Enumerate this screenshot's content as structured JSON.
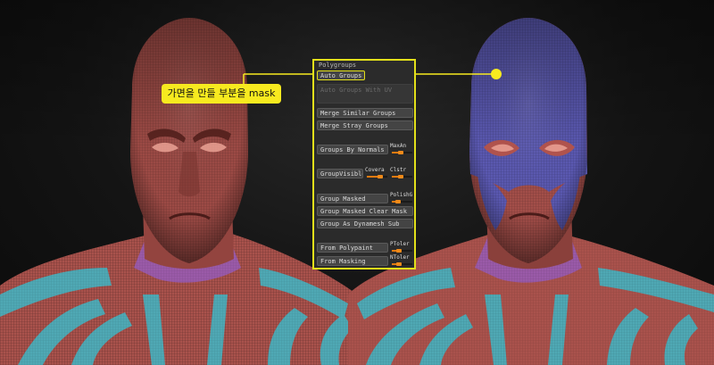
{
  "palette": {
    "title": "Polygroups",
    "buttons": {
      "auto_groups": "Auto Groups",
      "auto_groups_with_uv": "Auto Groups With UV",
      "merge_similar_groups": "Merge Similar Groups",
      "merge_stray_groups": "Merge Stray Groups",
      "groups_by_normals": "Groups By Normals",
      "group_visible": "GroupVisible",
      "group_masked": "Group Masked",
      "group_masked_clear_mask": "Group Masked Clear Mask",
      "group_as_dynamesh_sub": "Group As Dynamesh Sub",
      "from_polypaint": "From Polypaint",
      "from_masking": "From Masking"
    },
    "sliders": {
      "max_angle": "MaxAn",
      "coverage": "Covera",
      "clustering": "Clstr",
      "polish": "PolishG",
      "p_tolerance": "PToler",
      "n_tolerance": "NToler"
    }
  },
  "callout": {
    "text": "가면을 만들 부분을 mask"
  },
  "colors": {
    "highlight": "#e3e01a",
    "callout_bg": "#f7ea1f",
    "skin_red": "#a9524c",
    "mask_blue": "#5a58b0",
    "group_cyan": "#4fa8b4",
    "group_purple": "#9a5aa8",
    "slider_orange": "#f08a1a"
  }
}
